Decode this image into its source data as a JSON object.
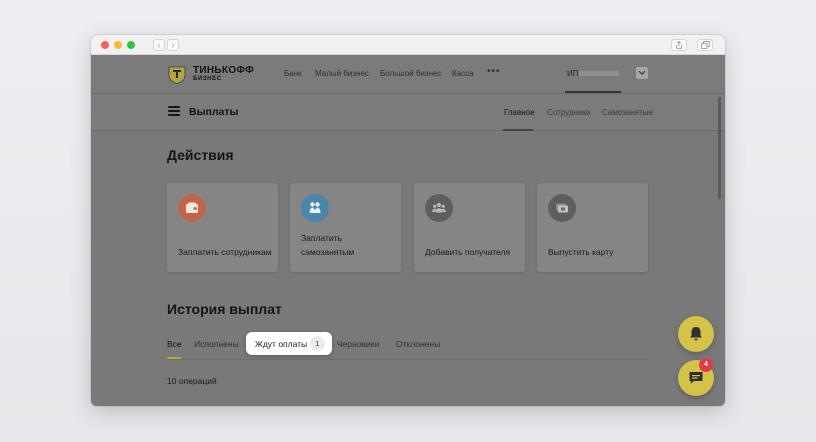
{
  "browser": {
    "back_icon": "‹",
    "forward_icon": "›"
  },
  "header": {
    "logo_line1": "ТИНЬКОФФ",
    "logo_line2": "БИЗНЕС",
    "nav": [
      "Банк",
      "Малый бизнес",
      "Большой бизнес",
      "Касса"
    ],
    "more": "•••",
    "org_label": "ИП"
  },
  "subheader": {
    "title": "Выплаты",
    "tabs": [
      "Главное",
      "Сотрудники",
      "Самозанятые"
    ],
    "active_tab": "Главное"
  },
  "actions": {
    "title": "Действия",
    "cards": [
      {
        "label": "Заплатить сотрудникам",
        "icon": "wallet-icon",
        "color": "#c2664a"
      },
      {
        "label": "Заплатить самозанятым",
        "icon": "handshake-icon",
        "color": "#4a86a9"
      },
      {
        "label": "Добавить получателя",
        "icon": "people-icon",
        "color": "#5e5e5e"
      },
      {
        "label": "Выпустить карту",
        "icon": "card-icon",
        "color": "#5e5e5e"
      }
    ]
  },
  "history": {
    "title": "История выплат",
    "tabs": [
      "Все",
      "Исполнены",
      "Ждут оплаты",
      "Черновики",
      "Отклонены"
    ],
    "active_tab": "Все",
    "highlighted_tab": "Ждут оплаты",
    "highlighted_count": "1",
    "operations_count": "10 операций"
  },
  "widgets": {
    "notifications_icon": "bell-icon",
    "chat_icon": "chat-icon",
    "chat_badge": "4",
    "accent": "#d3c348",
    "badge_color": "#e2394a"
  }
}
